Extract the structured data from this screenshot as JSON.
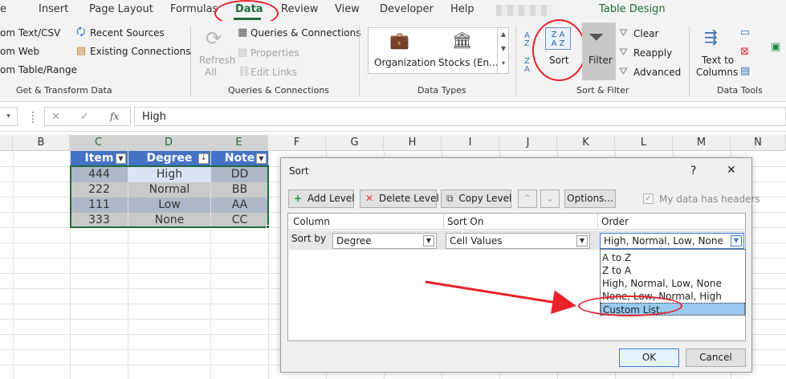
{
  "tabs": [
    "e",
    "Insert",
    "Page Layout",
    "Formulas",
    "Data",
    "Review",
    "View",
    "Developer",
    "Help",
    "Table Design"
  ],
  "ribbon": {
    "get_transform": {
      "from_text": "om Text/CSV",
      "from_web": "om Web",
      "from_table": "om Table/Range",
      "recent_sources": "Recent Sources",
      "existing_connections": "Existing Connections",
      "label": "Get & Transform Data"
    },
    "queries": {
      "refresh": "Refresh",
      "refresh_all": "All",
      "queries_connections": "Queries & Connections",
      "properties": "Properties",
      "edit_links": "Edit Links",
      "label": "Queries & Connections"
    },
    "data_types": {
      "organization": "Organization",
      "stocks": "Stocks (En...",
      "label": "Data Types"
    },
    "sort_filter": {
      "sort": "Sort",
      "filter": "Filter",
      "clear": "Clear",
      "reapply": "Reapply",
      "advanced": "Advanced",
      "az": "A\nZ",
      "za": "Z\nA",
      "label": "Sort & Filter"
    },
    "data_tools": {
      "text_to": "Text to",
      "columns": "Columns",
      "label": "Data Tools"
    }
  },
  "formula_bar": {
    "name_box": "",
    "fx": "fx",
    "value": "High"
  },
  "columns": [
    "B",
    "C",
    "D",
    "E",
    "F",
    "G",
    "H",
    "I",
    "J",
    "K",
    "L",
    "M",
    "N"
  ],
  "table": {
    "headers": [
      "Item",
      "Degree",
      "Note"
    ],
    "rows": [
      [
        "444",
        "High",
        "DD"
      ],
      [
        "222",
        "Normal",
        "BB"
      ],
      [
        "111",
        "Low",
        "AA"
      ],
      [
        "333",
        "None",
        "CC"
      ]
    ]
  },
  "dialog": {
    "title": "Sort",
    "help": "?",
    "close": "✕",
    "add_level": "Add Level",
    "delete_level": "Delete Level",
    "copy_level": "Copy Level",
    "options": "Options...",
    "my_data_headers": "My data has headers",
    "col_header": "Column",
    "sorton_header": "Sort On",
    "order_header": "Order",
    "sort_by": "Sort by",
    "column_value": "Degree",
    "sorton_value": "Cell Values",
    "order_value": "High, Normal, Low, None",
    "order_options": [
      "A to Z",
      "Z to A",
      "High, Normal, Low, None",
      "None, Low, Normal, High",
      "Custom List..."
    ],
    "ok": "OK",
    "cancel": "Cancel"
  },
  "colors": {
    "accent": "#1e6b3c",
    "table_header": "#4472c4",
    "highlight": "#e8222a",
    "selected_option": "#99c9ef"
  }
}
